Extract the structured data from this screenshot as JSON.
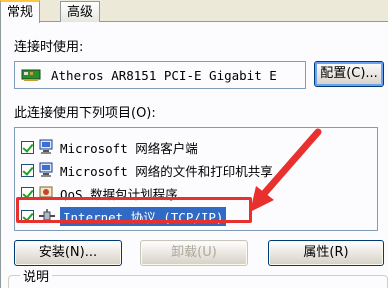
{
  "tabs": [
    {
      "label": "常规",
      "active": true
    },
    {
      "label": "高级",
      "active": false
    }
  ],
  "connect_using_label": "连接时使用:",
  "adapter": {
    "name": "Atheros AR8151 PCI-E Gigabit E"
  },
  "configure_button": "配置(C)...",
  "items_label": "此连接使用下列项目(O):",
  "items": [
    {
      "label": "Microsoft 网络客户端",
      "checked": true,
      "icon": "network-client-icon"
    },
    {
      "label": "Microsoft 网络的文件和打印机共享",
      "checked": true,
      "icon": "file-printer-sharing-icon"
    },
    {
      "label": "QoS 数据包计划程序",
      "checked": true,
      "icon": "qos-scheduler-icon"
    },
    {
      "label": "Internet 协议 (TCP/IP)",
      "checked": true,
      "icon": "protocol-icon",
      "selected": true
    }
  ],
  "buttons": {
    "install": "安装(N)...",
    "uninstall": "卸载(U)",
    "properties": "属性(R)"
  },
  "description_label": "说明",
  "colors": {
    "annotation": "#e8302e",
    "selection": "#316ac5",
    "tab_highlight": "#ffc73c"
  }
}
